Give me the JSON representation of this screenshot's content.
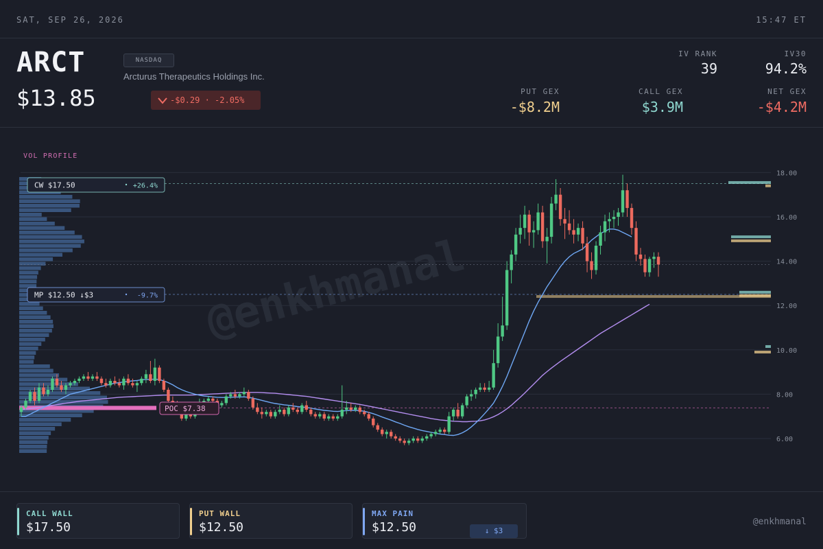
{
  "topbar": {
    "date": "SAT, SEP 26, 2026",
    "time": "15:47 ET"
  },
  "header": {
    "ticker": "ARCT",
    "exchange": "NASDAQ",
    "company": "Arcturus Therapeutics Holdings Inc.",
    "price": "$13.85",
    "change": "-$0.29 · -2.05%",
    "stats": {
      "iv_rank_label": "IV RANK",
      "iv_rank": "39",
      "iv30_label": "IV30",
      "iv30": "94.2%",
      "put_gex_label": "PUT GEX",
      "put_gex": "-$8.2M",
      "call_gex_label": "CALL GEX",
      "call_gex": "$3.9M",
      "net_gex_label": "NET GEX",
      "net_gex": "-$4.2M"
    }
  },
  "colors": {
    "up": "#4fc884",
    "down": "#ec6a5e",
    "sma_fast": "#6fa8f5",
    "sma_slow": "#b48ef0",
    "call": "#8fd8d0",
    "put": "#f0cf8e",
    "maxpain": "#7fa7f2",
    "poc": "#e36fbd",
    "profile": "#3e5f8c"
  },
  "chart_data": {
    "type": "candlestick",
    "title": "",
    "vol_profile_label": "VOL PROFILE",
    "y_ticks": [
      "6.00",
      "8.00",
      "10.00",
      "12.00",
      "14.00",
      "16.00",
      "18.00"
    ],
    "ylim": [
      5.4,
      18.1
    ],
    "current_price": 13.85,
    "levels": [
      {
        "key": "cw",
        "label": "CW $17.50",
        "pct": "+26.4%",
        "price": 17.5
      },
      {
        "key": "mp",
        "label": "MP $12.50 ↓$3",
        "pct": "-9.7%",
        "price": 12.5
      },
      {
        "key": "poc",
        "label": "POC $7.38",
        "price": 7.38
      }
    ],
    "candles": [
      [
        7.2,
        7.5,
        7.0,
        7.4
      ],
      [
        7.4,
        7.8,
        7.3,
        7.7
      ],
      [
        7.7,
        8.2,
        7.6,
        8.1
      ],
      [
        8.1,
        8.3,
        7.5,
        7.7
      ],
      [
        7.7,
        8.5,
        7.6,
        8.3
      ],
      [
        8.3,
        8.5,
        7.9,
        8.0
      ],
      [
        8.0,
        8.4,
        7.9,
        8.2
      ],
      [
        8.2,
        8.8,
        8.1,
        8.7
      ],
      [
        8.7,
        8.9,
        8.3,
        8.4
      ],
      [
        8.4,
        8.6,
        8.1,
        8.2
      ],
      [
        8.2,
        8.5,
        8.0,
        8.4
      ],
      [
        8.4,
        8.6,
        8.3,
        8.5
      ],
      [
        8.5,
        8.7,
        8.4,
        8.6
      ],
      [
        8.6,
        8.8,
        8.5,
        8.7
      ],
      [
        8.7,
        8.9,
        8.6,
        8.8
      ],
      [
        8.8,
        9.0,
        8.6,
        8.7
      ],
      [
        8.7,
        8.9,
        8.6,
        8.8
      ],
      [
        8.8,
        9.0,
        8.6,
        8.7
      ],
      [
        8.7,
        8.8,
        8.4,
        8.5
      ],
      [
        8.5,
        8.7,
        8.3,
        8.4
      ],
      [
        8.4,
        8.7,
        8.3,
        8.6
      ],
      [
        8.6,
        8.8,
        8.4,
        8.5
      ],
      [
        8.5,
        8.7,
        8.3,
        8.4
      ],
      [
        8.4,
        8.8,
        8.2,
        8.7
      ],
      [
        8.7,
        8.9,
        8.4,
        8.5
      ],
      [
        8.5,
        8.7,
        8.3,
        8.4
      ],
      [
        8.4,
        8.6,
        8.1,
        8.5
      ],
      [
        8.5,
        8.8,
        8.4,
        8.7
      ],
      [
        8.7,
        9.1,
        8.5,
        8.9
      ],
      [
        8.9,
        9.5,
        8.5,
        8.6
      ],
      [
        8.6,
        9.6,
        8.4,
        9.2
      ],
      [
        9.2,
        9.3,
        8.5,
        8.6
      ],
      [
        8.6,
        8.7,
        8.1,
        8.2
      ],
      [
        8.2,
        8.3,
        7.6,
        7.7
      ],
      [
        7.7,
        7.9,
        7.4,
        7.6
      ],
      [
        7.6,
        7.7,
        7.1,
        7.2
      ],
      [
        7.2,
        7.3,
        6.8,
        6.9
      ],
      [
        6.9,
        7.2,
        6.8,
        7.1
      ],
      [
        7.1,
        7.3,
        6.9,
        7.0
      ],
      [
        7.0,
        7.6,
        6.9,
        7.5
      ],
      [
        7.5,
        7.8,
        7.4,
        7.6
      ],
      [
        7.6,
        7.8,
        7.5,
        7.7
      ],
      [
        7.7,
        7.9,
        7.6,
        7.8
      ],
      [
        7.8,
        7.9,
        7.6,
        7.7
      ],
      [
        7.7,
        7.8,
        7.4,
        7.5
      ],
      [
        7.5,
        7.7,
        7.4,
        7.6
      ],
      [
        7.6,
        8.0,
        7.5,
        7.9
      ],
      [
        7.9,
        8.1,
        7.8,
        8.0
      ],
      [
        8.0,
        8.2,
        7.8,
        7.9
      ],
      [
        7.9,
        8.1,
        7.8,
        8.0
      ],
      [
        8.0,
        8.3,
        7.9,
        8.1
      ],
      [
        8.1,
        8.2,
        7.7,
        7.8
      ],
      [
        7.8,
        7.9,
        7.3,
        7.4
      ],
      [
        7.4,
        7.6,
        7.1,
        7.2
      ],
      [
        7.2,
        7.4,
        6.9,
        7.1
      ],
      [
        7.1,
        7.3,
        7.0,
        7.2
      ],
      [
        7.2,
        7.3,
        6.9,
        7.0
      ],
      [
        7.0,
        7.3,
        6.9,
        7.2
      ],
      [
        7.2,
        7.5,
        7.1,
        7.3
      ],
      [
        7.3,
        7.4,
        7.0,
        7.1
      ],
      [
        7.1,
        7.5,
        7.0,
        7.4
      ],
      [
        7.4,
        7.6,
        7.2,
        7.3
      ],
      [
        7.3,
        7.4,
        7.1,
        7.2
      ],
      [
        7.2,
        7.6,
        7.1,
        7.5
      ],
      [
        7.5,
        7.7,
        7.2,
        7.3
      ],
      [
        7.3,
        7.4,
        7.0,
        7.1
      ],
      [
        7.1,
        7.2,
        6.9,
        7.0
      ],
      [
        7.0,
        7.2,
        6.9,
        7.1
      ],
      [
        7.1,
        7.2,
        6.8,
        6.9
      ],
      [
        6.9,
        7.1,
        6.8,
        7.0
      ],
      [
        7.0,
        7.1,
        6.8,
        6.9
      ],
      [
        6.9,
        7.1,
        6.8,
        7.0
      ],
      [
        7.0,
        8.4,
        6.9,
        7.3
      ],
      [
        7.3,
        7.7,
        7.1,
        7.4
      ],
      [
        7.4,
        7.6,
        7.2,
        7.3
      ],
      [
        7.3,
        7.5,
        7.2,
        7.4
      ],
      [
        7.4,
        7.5,
        7.1,
        7.2
      ],
      [
        7.2,
        7.3,
        7.0,
        7.1
      ],
      [
        7.1,
        7.2,
        6.8,
        6.9
      ],
      [
        6.9,
        7.0,
        6.5,
        6.6
      ],
      [
        6.6,
        6.7,
        6.3,
        6.4
      ],
      [
        6.4,
        6.5,
        6.1,
        6.2
      ],
      [
        6.2,
        6.4,
        6.0,
        6.3
      ],
      [
        6.3,
        6.4,
        6.0,
        6.1
      ],
      [
        6.1,
        6.2,
        5.9,
        6.0
      ],
      [
        6.0,
        6.1,
        5.8,
        5.9
      ],
      [
        5.9,
        6.0,
        5.7,
        5.8
      ],
      [
        5.8,
        6.0,
        5.7,
        5.9
      ],
      [
        5.9,
        6.1,
        5.8,
        6.0
      ],
      [
        6.0,
        6.1,
        5.8,
        5.9
      ],
      [
        5.9,
        6.1,
        5.8,
        6.0
      ],
      [
        6.0,
        6.2,
        5.9,
        6.1
      ],
      [
        6.1,
        6.3,
        6.0,
        6.2
      ],
      [
        6.2,
        6.4,
        6.1,
        6.3
      ],
      [
        6.3,
        6.5,
        6.2,
        6.4
      ],
      [
        6.4,
        6.5,
        6.2,
        6.3
      ],
      [
        6.3,
        7.2,
        6.2,
        7.0
      ],
      [
        7.0,
        7.4,
        6.8,
        7.3
      ],
      [
        7.3,
        7.6,
        6.9,
        7.0
      ],
      [
        7.0,
        7.6,
        6.9,
        7.5
      ],
      [
        7.5,
        8.0,
        7.4,
        7.9
      ],
      [
        7.9,
        8.2,
        7.7,
        8.0
      ],
      [
        8.0,
        8.3,
        7.8,
        8.2
      ],
      [
        8.2,
        8.5,
        8.1,
        8.3
      ],
      [
        8.3,
        8.5,
        8.1,
        8.2
      ],
      [
        8.2,
        8.6,
        8.1,
        8.3
      ],
      [
        8.3,
        10.0,
        8.2,
        9.4
      ],
      [
        9.4,
        11.2,
        9.2,
        10.6
      ],
      [
        10.6,
        12.4,
        10.4,
        11.1
      ],
      [
        11.1,
        14.0,
        10.9,
        13.6
      ],
      [
        13.6,
        14.5,
        13.0,
        14.3
      ],
      [
        14.3,
        15.5,
        14.0,
        15.2
      ],
      [
        15.2,
        16.1,
        14.8,
        15.5
      ],
      [
        15.5,
        16.5,
        15.0,
        16.1
      ],
      [
        16.1,
        16.3,
        14.7,
        15.3
      ],
      [
        15.3,
        15.8,
        14.6,
        15.4
      ],
      [
        15.4,
        16.6,
        15.2,
        16.2
      ],
      [
        16.2,
        16.5,
        14.6,
        14.9
      ],
      [
        14.9,
        15.5,
        13.9,
        15.1
      ],
      [
        15.1,
        16.9,
        14.8,
        16.6
      ],
      [
        16.6,
        17.7,
        16.3,
        17.0
      ],
      [
        17.0,
        17.3,
        15.6,
        15.9
      ],
      [
        15.9,
        16.4,
        15.0,
        15.7
      ],
      [
        15.7,
        16.3,
        15.2,
        15.4
      ],
      [
        15.4,
        15.9,
        14.8,
        15.2
      ],
      [
        15.2,
        15.7,
        14.9,
        15.5
      ],
      [
        15.5,
        15.8,
        14.5,
        14.8
      ],
      [
        14.8,
        15.1,
        13.5,
        14.0
      ],
      [
        14.0,
        14.4,
        13.2,
        13.6
      ],
      [
        13.6,
        14.9,
        13.4,
        14.7
      ],
      [
        14.7,
        15.6,
        14.3,
        15.3
      ],
      [
        15.3,
        16.1,
        14.9,
        15.8
      ],
      [
        15.8,
        16.2,
        15.3,
        15.9
      ],
      [
        15.9,
        16.3,
        15.5,
        16.0
      ],
      [
        16.0,
        16.4,
        15.6,
        16.2
      ],
      [
        16.2,
        17.9,
        16.0,
        17.2
      ],
      [
        17.2,
        17.5,
        16.0,
        16.4
      ],
      [
        16.4,
        16.6,
        15.2,
        15.5
      ],
      [
        15.5,
        15.8,
        14.0,
        14.3
      ],
      [
        14.3,
        14.6,
        13.8,
        14.1
      ],
      [
        14.1,
        14.3,
        13.3,
        13.5
      ],
      [
        13.5,
        14.2,
        13.3,
        14.1
      ],
      [
        14.1,
        14.4,
        13.7,
        14.2
      ],
      [
        14.2,
        14.4,
        13.3,
        13.85
      ]
    ],
    "sma_fast": [
      7.0,
      7.0,
      7.1,
      7.2,
      7.3,
      7.4,
      7.5,
      7.6,
      7.7,
      7.8,
      7.9,
      8.0,
      8.05,
      8.1,
      8.15,
      8.2,
      8.25,
      8.3,
      8.35,
      8.4,
      8.45,
      8.5,
      8.52,
      8.55,
      8.58,
      8.6,
      8.62,
      8.65,
      8.66,
      8.67,
      8.68,
      8.66,
      8.6,
      8.52,
      8.42,
      8.3,
      8.2,
      8.12,
      8.06,
      8.0,
      7.95,
      7.92,
      7.9,
      7.88,
      7.86,
      7.85,
      7.85,
      7.86,
      7.87,
      7.87,
      7.88,
      7.86,
      7.82,
      7.77,
      7.72,
      7.67,
      7.62,
      7.58,
      7.55,
      7.52,
      7.5,
      7.47,
      7.44,
      7.42,
      7.4,
      7.37,
      7.33,
      7.3,
      7.27,
      7.25,
      7.23,
      7.22,
      7.24,
      7.26,
      7.27,
      7.27,
      7.26,
      7.23,
      7.18,
      7.12,
      7.05,
      6.97,
      6.9,
      6.83,
      6.75,
      6.68,
      6.6,
      6.53,
      6.47,
      6.41,
      6.36,
      6.32,
      6.28,
      6.24,
      6.2,
      6.18,
      6.15,
      6.14,
      6.18,
      6.26,
      6.37,
      6.52,
      6.7,
      6.9,
      7.12,
      7.35,
      7.6,
      7.95,
      8.35,
      8.8,
      9.3,
      9.8,
      10.3,
      10.8,
      11.3,
      11.75,
      12.15,
      12.5,
      12.85,
      13.15,
      13.45,
      13.75,
      14.0,
      14.2,
      14.35,
      14.45,
      14.55,
      14.75,
      14.95,
      15.1,
      15.25,
      15.35,
      15.45,
      15.45,
      15.4,
      15.3,
      15.2,
      15.1
    ],
    "sma_slow": [
      7.3,
      7.32,
      7.35,
      7.38,
      7.41,
      7.44,
      7.47,
      7.5,
      7.53,
      7.56,
      7.59,
      7.62,
      7.65,
      7.68,
      7.7,
      7.72,
      7.74,
      7.76,
      7.78,
      7.8,
      7.82,
      7.84,
      7.86,
      7.87,
      7.88,
      7.89,
      7.9,
      7.91,
      7.92,
      7.93,
      7.94,
      7.95,
      7.96,
      7.96,
      7.96,
      7.96,
      7.96,
      7.96,
      7.96,
      7.97,
      7.98,
      7.99,
      8.0,
      8.01,
      8.02,
      8.03,
      8.04,
      8.05,
      8.06,
      8.07,
      8.08,
      8.08,
      8.08,
      8.08,
      8.07,
      8.06,
      8.05,
      8.04,
      8.02,
      8.0,
      7.98,
      7.96,
      7.94,
      7.92,
      7.9,
      7.87,
      7.84,
      7.81,
      7.78,
      7.75,
      7.72,
      7.69,
      7.66,
      7.63,
      7.6,
      7.57,
      7.54,
      7.5,
      7.46,
      7.42,
      7.38,
      7.34,
      7.3,
      7.26,
      7.22,
      7.18,
      7.14,
      7.1,
      7.06,
      7.02,
      6.98,
      6.94,
      6.9,
      6.87,
      6.84,
      6.82,
      6.8,
      6.78,
      6.77,
      6.76,
      6.76,
      6.77,
      6.78,
      6.8,
      6.84,
      6.9,
      6.98,
      7.08,
      7.2,
      7.34,
      7.5,
      7.68,
      7.86,
      8.05,
      8.25,
      8.45,
      8.65,
      8.85,
      9.02,
      9.18,
      9.33,
      9.48,
      9.62,
      9.76,
      9.9,
      10.04,
      10.18,
      10.32,
      10.46,
      10.6,
      10.74,
      10.86,
      10.98,
      11.1,
      11.22,
      11.34,
      11.46,
      11.58,
      11.7,
      11.82,
      11.94,
      12.06
    ]
  },
  "bottom": {
    "call_wall_label": "CALL WALL",
    "call_wall": "$17.50",
    "put_wall_label": "PUT WALL",
    "put_wall": "$12.50",
    "max_pain_label": "MAX PAIN",
    "max_pain": "$12.50",
    "max_pain_delta": "↓ $3",
    "handle": "@enkhmanal"
  },
  "watermark": "@enkhmanal"
}
